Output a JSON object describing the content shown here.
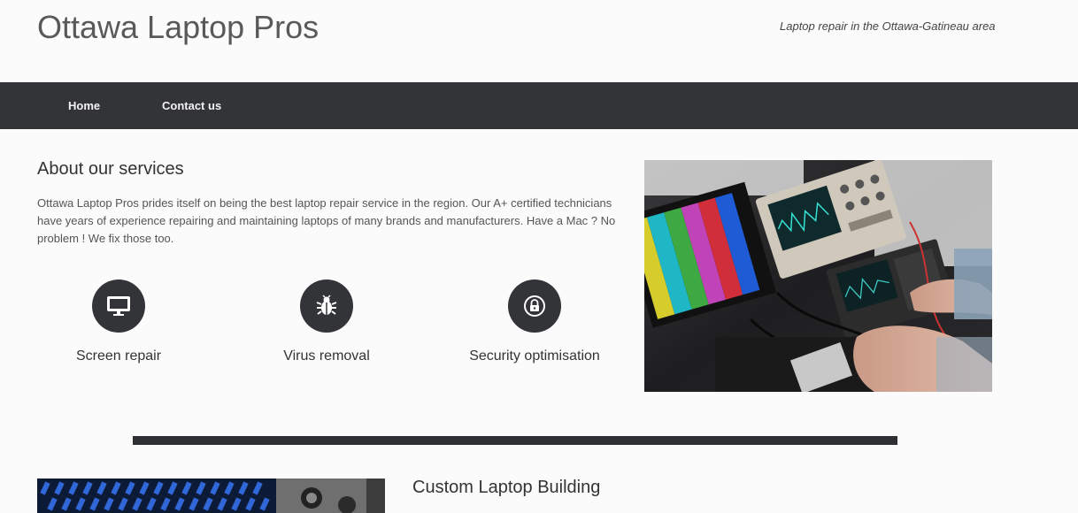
{
  "header": {
    "site_title": "Ottawa Laptop Pros",
    "tagline": "Laptop repair in the Ottawa-Gatineau area"
  },
  "nav": {
    "items": [
      {
        "label": "Home"
      },
      {
        "label": "Contact us"
      }
    ]
  },
  "about": {
    "heading": "About our services",
    "text": "Ottawa Laptop Pros prides itself on being the best laptop repair service in the region. Our A+ certified technicians have years of experience repairing and maintaining laptops of many brands and manufacturers. Have a Mac ? No problem ! We fix those too."
  },
  "services": [
    {
      "label": "Screen repair",
      "icon": "monitor-icon"
    },
    {
      "label": "Virus removal",
      "icon": "bug-icon"
    },
    {
      "label": "Security optimisation",
      "icon": "lock-icon"
    }
  ],
  "custom": {
    "heading": "Custom Laptop Building"
  },
  "colors": {
    "nav_bg": "#333438",
    "icon_circle": "#333438",
    "divider": "#2e2f33",
    "page_bg": "#fbfbfb"
  }
}
